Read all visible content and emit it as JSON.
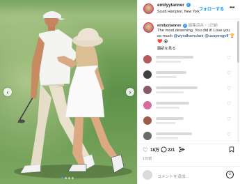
{
  "header": {
    "username": "emilyytanner",
    "verified_mark": "✓",
    "location": "South Hampton, New York",
    "follow_label": "フォローする",
    "more_label": "•••"
  },
  "caption": {
    "username": "emilyytanner",
    "edited_label": "編集済み",
    "separator": "・",
    "age": "1日前",
    "text_before": "The most deserving. You did it! Love you so much ",
    "mention1": "@wyndhamclark",
    "text_between": " ",
    "mention2": "@usopengolf",
    "text_after": " 🏆 ❤️ 😭",
    "translate_label": "翻訳を見る"
  },
  "comments": [
    {
      "avatar_color": "#b45a5a"
    },
    {
      "avatar_color": "#3f3f3f"
    },
    {
      "avatar_color": "#8a5a6a"
    },
    {
      "avatar_color": "#d86aa0"
    },
    {
      "avatar_color": "#a05a4a"
    },
    {
      "avatar_color": "#6a6a6a"
    }
  ],
  "actions": {
    "like_count": "18万",
    "comment_count": "221",
    "like_icon": "heart-icon",
    "comment_icon": "comment-icon",
    "share_icon": "share-icon",
    "save_icon": "bookmark-icon"
  },
  "date": "1日前",
  "comment_input": {
    "placeholder": "コメントを追加..."
  },
  "colors": {
    "accent": "#0095f6",
    "verified": "#3897f0"
  },
  "carousel": {
    "prev_glyph": "‹",
    "next_glyph": "›",
    "slide_count": 4,
    "active_index": 0
  }
}
